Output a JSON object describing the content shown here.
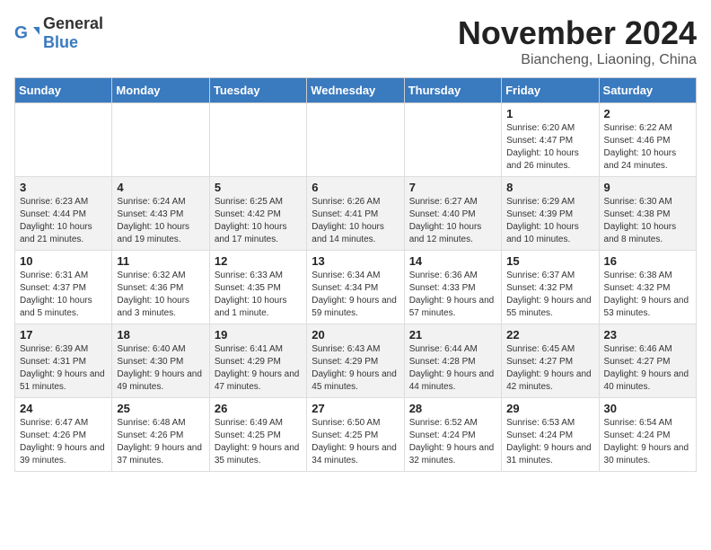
{
  "header": {
    "logo_general": "General",
    "logo_blue": "Blue",
    "month_year": "November 2024",
    "location": "Biancheng, Liaoning, China"
  },
  "weekdays": [
    "Sunday",
    "Monday",
    "Tuesday",
    "Wednesday",
    "Thursday",
    "Friday",
    "Saturday"
  ],
  "weeks": [
    [
      {
        "day": "",
        "info": ""
      },
      {
        "day": "",
        "info": ""
      },
      {
        "day": "",
        "info": ""
      },
      {
        "day": "",
        "info": ""
      },
      {
        "day": "",
        "info": ""
      },
      {
        "day": "1",
        "info": "Sunrise: 6:20 AM\nSunset: 4:47 PM\nDaylight: 10 hours and 26 minutes."
      },
      {
        "day": "2",
        "info": "Sunrise: 6:22 AM\nSunset: 4:46 PM\nDaylight: 10 hours and 24 minutes."
      }
    ],
    [
      {
        "day": "3",
        "info": "Sunrise: 6:23 AM\nSunset: 4:44 PM\nDaylight: 10 hours and 21 minutes."
      },
      {
        "day": "4",
        "info": "Sunrise: 6:24 AM\nSunset: 4:43 PM\nDaylight: 10 hours and 19 minutes."
      },
      {
        "day": "5",
        "info": "Sunrise: 6:25 AM\nSunset: 4:42 PM\nDaylight: 10 hours and 17 minutes."
      },
      {
        "day": "6",
        "info": "Sunrise: 6:26 AM\nSunset: 4:41 PM\nDaylight: 10 hours and 14 minutes."
      },
      {
        "day": "7",
        "info": "Sunrise: 6:27 AM\nSunset: 4:40 PM\nDaylight: 10 hours and 12 minutes."
      },
      {
        "day": "8",
        "info": "Sunrise: 6:29 AM\nSunset: 4:39 PM\nDaylight: 10 hours and 10 minutes."
      },
      {
        "day": "9",
        "info": "Sunrise: 6:30 AM\nSunset: 4:38 PM\nDaylight: 10 hours and 8 minutes."
      }
    ],
    [
      {
        "day": "10",
        "info": "Sunrise: 6:31 AM\nSunset: 4:37 PM\nDaylight: 10 hours and 5 minutes."
      },
      {
        "day": "11",
        "info": "Sunrise: 6:32 AM\nSunset: 4:36 PM\nDaylight: 10 hours and 3 minutes."
      },
      {
        "day": "12",
        "info": "Sunrise: 6:33 AM\nSunset: 4:35 PM\nDaylight: 10 hours and 1 minute."
      },
      {
        "day": "13",
        "info": "Sunrise: 6:34 AM\nSunset: 4:34 PM\nDaylight: 9 hours and 59 minutes."
      },
      {
        "day": "14",
        "info": "Sunrise: 6:36 AM\nSunset: 4:33 PM\nDaylight: 9 hours and 57 minutes."
      },
      {
        "day": "15",
        "info": "Sunrise: 6:37 AM\nSunset: 4:32 PM\nDaylight: 9 hours and 55 minutes."
      },
      {
        "day": "16",
        "info": "Sunrise: 6:38 AM\nSunset: 4:32 PM\nDaylight: 9 hours and 53 minutes."
      }
    ],
    [
      {
        "day": "17",
        "info": "Sunrise: 6:39 AM\nSunset: 4:31 PM\nDaylight: 9 hours and 51 minutes."
      },
      {
        "day": "18",
        "info": "Sunrise: 6:40 AM\nSunset: 4:30 PM\nDaylight: 9 hours and 49 minutes."
      },
      {
        "day": "19",
        "info": "Sunrise: 6:41 AM\nSunset: 4:29 PM\nDaylight: 9 hours and 47 minutes."
      },
      {
        "day": "20",
        "info": "Sunrise: 6:43 AM\nSunset: 4:29 PM\nDaylight: 9 hours and 45 minutes."
      },
      {
        "day": "21",
        "info": "Sunrise: 6:44 AM\nSunset: 4:28 PM\nDaylight: 9 hours and 44 minutes."
      },
      {
        "day": "22",
        "info": "Sunrise: 6:45 AM\nSunset: 4:27 PM\nDaylight: 9 hours and 42 minutes."
      },
      {
        "day": "23",
        "info": "Sunrise: 6:46 AM\nSunset: 4:27 PM\nDaylight: 9 hours and 40 minutes."
      }
    ],
    [
      {
        "day": "24",
        "info": "Sunrise: 6:47 AM\nSunset: 4:26 PM\nDaylight: 9 hours and 39 minutes."
      },
      {
        "day": "25",
        "info": "Sunrise: 6:48 AM\nSunset: 4:26 PM\nDaylight: 9 hours and 37 minutes."
      },
      {
        "day": "26",
        "info": "Sunrise: 6:49 AM\nSunset: 4:25 PM\nDaylight: 9 hours and 35 minutes."
      },
      {
        "day": "27",
        "info": "Sunrise: 6:50 AM\nSunset: 4:25 PM\nDaylight: 9 hours and 34 minutes."
      },
      {
        "day": "28",
        "info": "Sunrise: 6:52 AM\nSunset: 4:24 PM\nDaylight: 9 hours and 32 minutes."
      },
      {
        "day": "29",
        "info": "Sunrise: 6:53 AM\nSunset: 4:24 PM\nDaylight: 9 hours and 31 minutes."
      },
      {
        "day": "30",
        "info": "Sunrise: 6:54 AM\nSunset: 4:24 PM\nDaylight: 9 hours and 30 minutes."
      }
    ]
  ]
}
